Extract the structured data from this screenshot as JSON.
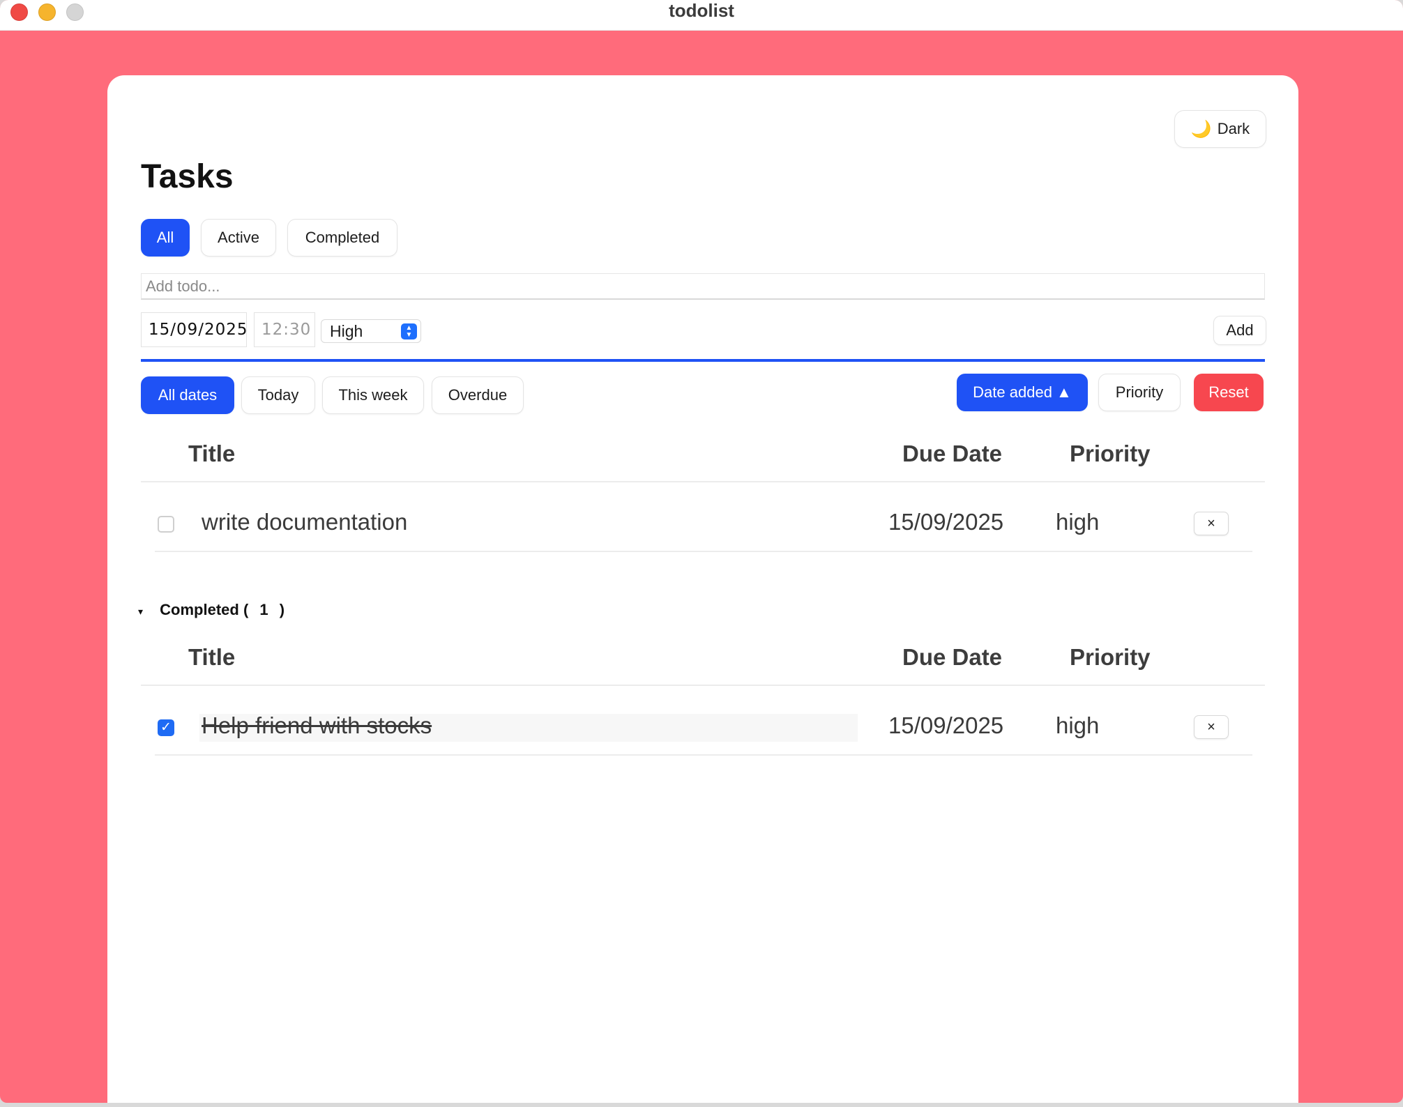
{
  "window": {
    "title": "todolist"
  },
  "theme_toggle": {
    "icon": "moon-icon",
    "glyph": "🌙",
    "label": "Dark"
  },
  "page_title": "Tasks",
  "status_filters": [
    {
      "label": "All",
      "active": true
    },
    {
      "label": "Active",
      "active": false
    },
    {
      "label": "Completed",
      "active": false
    }
  ],
  "new_todo": {
    "placeholder": "Add todo...",
    "value": "",
    "date": "15/09/2025",
    "time_placeholder": "12:30",
    "priority": "High",
    "add_label": "Add"
  },
  "date_filters": [
    {
      "label": "All dates",
      "active": true
    },
    {
      "label": "Today",
      "active": false
    },
    {
      "label": "This week",
      "active": false
    },
    {
      "label": "Overdue",
      "active": false
    }
  ],
  "sort": {
    "date_added_label": "Date added ▲",
    "priority_label": "Priority",
    "reset_label": "Reset"
  },
  "columns": {
    "title": "Title",
    "due_date": "Due Date",
    "priority": "Priority"
  },
  "active_tasks": [
    {
      "title": "write documentation",
      "due_date": "15/09/2025",
      "priority": "high",
      "done": false,
      "delete_label": "×"
    }
  ],
  "completed_section": {
    "toggle_glyph": "▾",
    "label": "Completed (",
    "count": "1",
    "close": ")"
  },
  "completed_tasks": [
    {
      "title": "Help friend with stocks",
      "due_date": "15/09/2025",
      "priority": "high",
      "done": true,
      "delete_label": "×"
    }
  ],
  "colors": {
    "background": "#ff6b7b",
    "primary": "#1f52f5",
    "danger": "#f7474f",
    "checkbox_checked": "#1f6bf4"
  }
}
